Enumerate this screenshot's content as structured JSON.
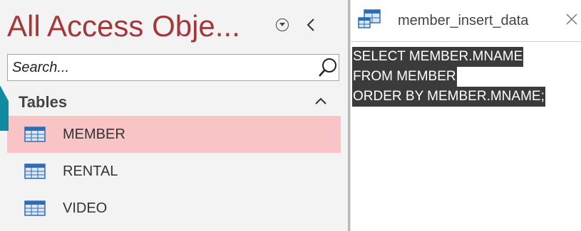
{
  "nav": {
    "title": "All Access Obje...",
    "menu_icon": "circle-chevron-down-icon",
    "collapse_icon": "chevron-left-icon",
    "search": {
      "placeholder": "Search...",
      "value": ""
    },
    "group": {
      "label": "Tables",
      "toggle_icon": "chevron-up-icon"
    },
    "items": [
      {
        "label": "MEMBER",
        "icon": "table-icon",
        "selected": true
      },
      {
        "label": "RENTAL",
        "icon": "table-icon",
        "selected": false
      },
      {
        "label": "VIDEO",
        "icon": "table-icon",
        "selected": false
      }
    ]
  },
  "tab": {
    "label": "member_insert_data",
    "icon": "query-icon",
    "close_icon": "close-icon"
  },
  "editor": {
    "lines": [
      "SELECT MEMBER.MNAME",
      "FROM MEMBER",
      "ORDER BY MEMBER.MNAME;"
    ]
  },
  "colors": {
    "title": "#a4373a",
    "selected_row": "#f9c4c6",
    "selection_highlight": "#3b3b3b",
    "callout": "#0f8aa0"
  }
}
